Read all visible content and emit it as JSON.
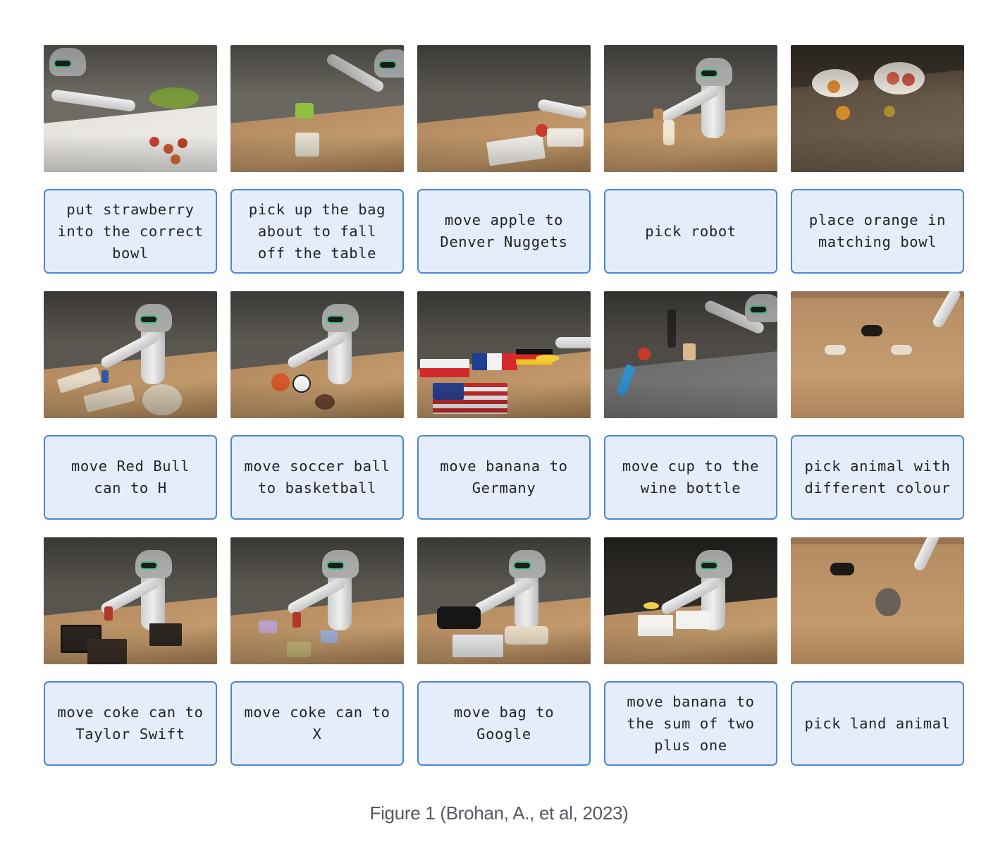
{
  "rows": [
    {
      "panels": [
        {
          "scene": "robot-kitchen-strawberry-bowls",
          "caption": "put strawberry\ninto the correct\nbowl"
        },
        {
          "scene": "robot-table-chip-bag",
          "caption": "pick up the bag\nabout to fall\noff the table"
        },
        {
          "scene": "robot-table-apple-cards",
          "caption": "move apple to\nDenver Nuggets"
        },
        {
          "scene": "robot-table-robot-toy",
          "caption": "pick robot"
        },
        {
          "scene": "table-orange-bowls",
          "caption": "place orange in\nmatching bowl"
        }
      ]
    },
    {
      "panels": [
        {
          "scene": "robot-table-letters-redbull",
          "caption": "move Red Bull\ncan to H"
        },
        {
          "scene": "robot-table-balls",
          "caption": "move soccer ball\nto basketball"
        },
        {
          "scene": "robot-table-flags-banana",
          "caption": "move banana to\nGermany"
        },
        {
          "scene": "robot-table-cup-wine-bottle",
          "caption": "move cup to the\nwine bottle"
        },
        {
          "scene": "table-animal-toys",
          "caption": "pick animal with\ndifferent colour"
        }
      ]
    },
    {
      "panels": [
        {
          "scene": "robot-table-picture-frames",
          "caption": "move coke can to\nTaylor Swift"
        },
        {
          "scene": "robot-table-letter-stickers",
          "caption": "move coke can to\nX"
        },
        {
          "scene": "robot-table-bag-google",
          "caption": "move bag to\nGoogle"
        },
        {
          "scene": "robot-table-number-cards",
          "caption": "move banana to\nthe sum of two\nplus one"
        },
        {
          "scene": "table-octopus-horse",
          "caption": "pick land animal"
        }
      ]
    }
  ],
  "figure_caption": "Figure 1 (Brohan, A., et al, 2023)"
}
